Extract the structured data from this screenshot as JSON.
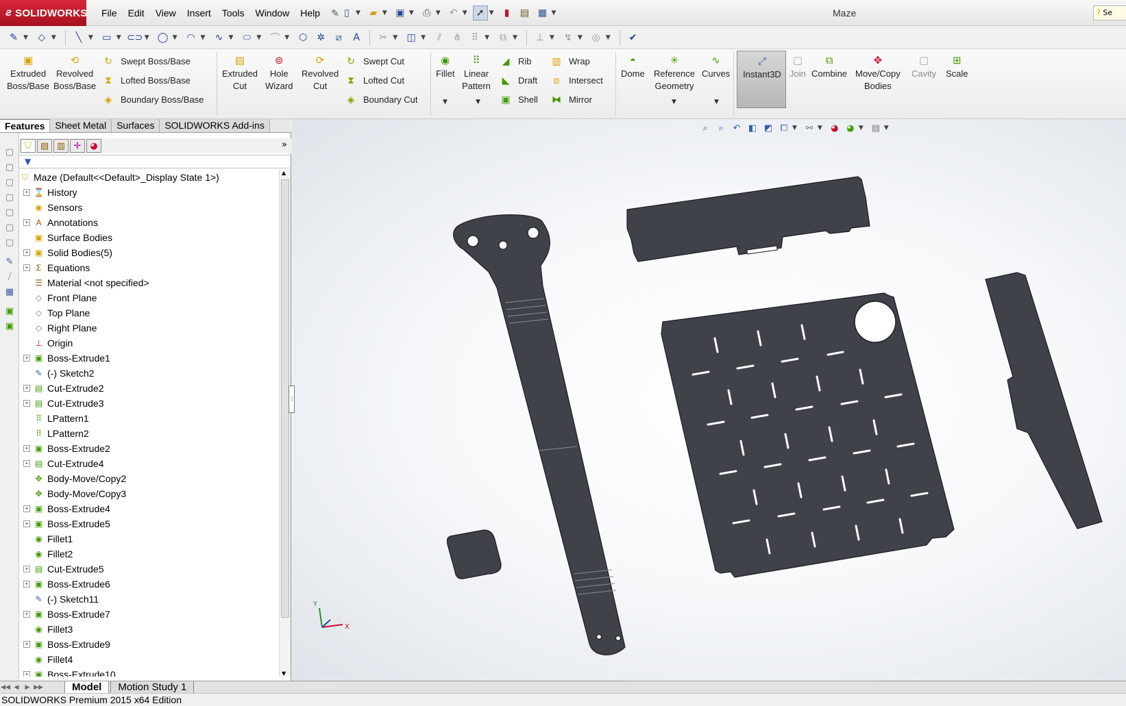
{
  "app": {
    "logo_text": "SOLIDWORKS",
    "doc_title": "Maze",
    "help_placeholder": "Se"
  },
  "menu": [
    "File",
    "Edit",
    "View",
    "Insert",
    "Tools",
    "Window",
    "Help"
  ],
  "cmd": {
    "extruded_boss": "Extruded\nBoss/Base",
    "revolved_boss": "Revolved\nBoss/Base",
    "swept_boss": "Swept Boss/Base",
    "lofted_boss": "Lofted Boss/Base",
    "boundary_boss": "Boundary Boss/Base",
    "extruded_cut": "Extruded\nCut",
    "hole_wizard": "Hole\nWizard",
    "revolved_cut": "Revolved\nCut",
    "swept_cut": "Swept Cut",
    "lofted_cut": "Lofted Cut",
    "boundary_cut": "Boundary Cut",
    "fillet": "Fillet",
    "linear_pattern": "Linear\nPattern",
    "rib": "Rib",
    "draft": "Draft",
    "shell": "Shell",
    "wrap": "Wrap",
    "intersect": "Intersect",
    "mirror": "Mirror",
    "dome": "Dome",
    "reference_geometry": "Reference\nGeometry",
    "curves": "Curves",
    "instant3d": "Instant3D",
    "join": "Join",
    "combine": "Combine",
    "move_copy": "Move/Copy\nBodies",
    "cavity": "Cavity",
    "scale": "Scale"
  },
  "cm_tabs": [
    "Features",
    "Sheet Metal",
    "Surfaces",
    "SOLIDWORKS Add-ins"
  ],
  "tree": {
    "root": "Maze  (Default<<Default>_Display State 1>)",
    "items": [
      {
        "label": "History",
        "exp": true,
        "icon": "history-icon"
      },
      {
        "label": "Sensors",
        "exp": false,
        "icon": "sensors-icon"
      },
      {
        "label": "Annotations",
        "exp": true,
        "icon": "annotations-icon"
      },
      {
        "label": "Surface Bodies",
        "exp": false,
        "icon": "surface-bodies-icon"
      },
      {
        "label": "Solid Bodies(5)",
        "exp": true,
        "icon": "solid-bodies-icon"
      },
      {
        "label": "Equations",
        "exp": true,
        "icon": "equations-icon"
      },
      {
        "label": "Material <not specified>",
        "exp": false,
        "icon": "material-icon"
      },
      {
        "label": "Front Plane",
        "exp": false,
        "icon": "plane-icon"
      },
      {
        "label": "Top Plane",
        "exp": false,
        "icon": "plane-icon"
      },
      {
        "label": "Right Plane",
        "exp": false,
        "icon": "plane-icon"
      },
      {
        "label": "Origin",
        "exp": false,
        "icon": "origin-icon"
      },
      {
        "label": "Boss-Extrude1",
        "exp": true,
        "icon": "boss-extrude-icon"
      },
      {
        "label": "(-) Sketch2",
        "exp": false,
        "icon": "sketch-icon"
      },
      {
        "label": "Cut-Extrude2",
        "exp": true,
        "icon": "cut-extrude-icon"
      },
      {
        "label": "Cut-Extrude3",
        "exp": true,
        "icon": "cut-extrude-icon"
      },
      {
        "label": "LPattern1",
        "exp": false,
        "icon": "linear-pattern-icon"
      },
      {
        "label": "LPattern2",
        "exp": false,
        "icon": "linear-pattern-icon"
      },
      {
        "label": "Boss-Extrude2",
        "exp": true,
        "icon": "boss-extrude-icon"
      },
      {
        "label": "Cut-Extrude4",
        "exp": true,
        "icon": "cut-extrude-icon"
      },
      {
        "label": "Body-Move/Copy2",
        "exp": false,
        "icon": "move-copy-icon"
      },
      {
        "label": "Body-Move/Copy3",
        "exp": false,
        "icon": "move-copy-icon"
      },
      {
        "label": "Boss-Extrude4",
        "exp": true,
        "icon": "boss-extrude-icon"
      },
      {
        "label": "Boss-Extrude5",
        "exp": true,
        "icon": "boss-extrude-icon"
      },
      {
        "label": "Fillet1",
        "exp": false,
        "icon": "fillet-icon"
      },
      {
        "label": "Fillet2",
        "exp": false,
        "icon": "fillet-icon"
      },
      {
        "label": "Cut-Extrude5",
        "exp": true,
        "icon": "cut-extrude-icon"
      },
      {
        "label": "Boss-Extrude6",
        "exp": true,
        "icon": "boss-extrude-icon"
      },
      {
        "label": "(-) Sketch11",
        "exp": false,
        "icon": "sketch-icon"
      },
      {
        "label": "Boss-Extrude7",
        "exp": true,
        "icon": "boss-extrude-icon"
      },
      {
        "label": "Fillet3",
        "exp": false,
        "icon": "fillet-icon"
      },
      {
        "label": "Boss-Extrude9",
        "exp": true,
        "icon": "boss-extrude-icon"
      },
      {
        "label": "Fillet4",
        "exp": false,
        "icon": "fillet-icon"
      },
      {
        "label": "Boss-Extrude10",
        "exp": true,
        "icon": "boss-extrude-icon"
      }
    ]
  },
  "bottom_tabs": [
    "Model",
    "Motion Study 1"
  ],
  "status": "SOLIDWORKS Premium 2015 x64 Edition",
  "triad": {
    "x": "X",
    "y": "Y"
  },
  "colors": {
    "part": "#3f4148",
    "accent": "#c8102e"
  }
}
